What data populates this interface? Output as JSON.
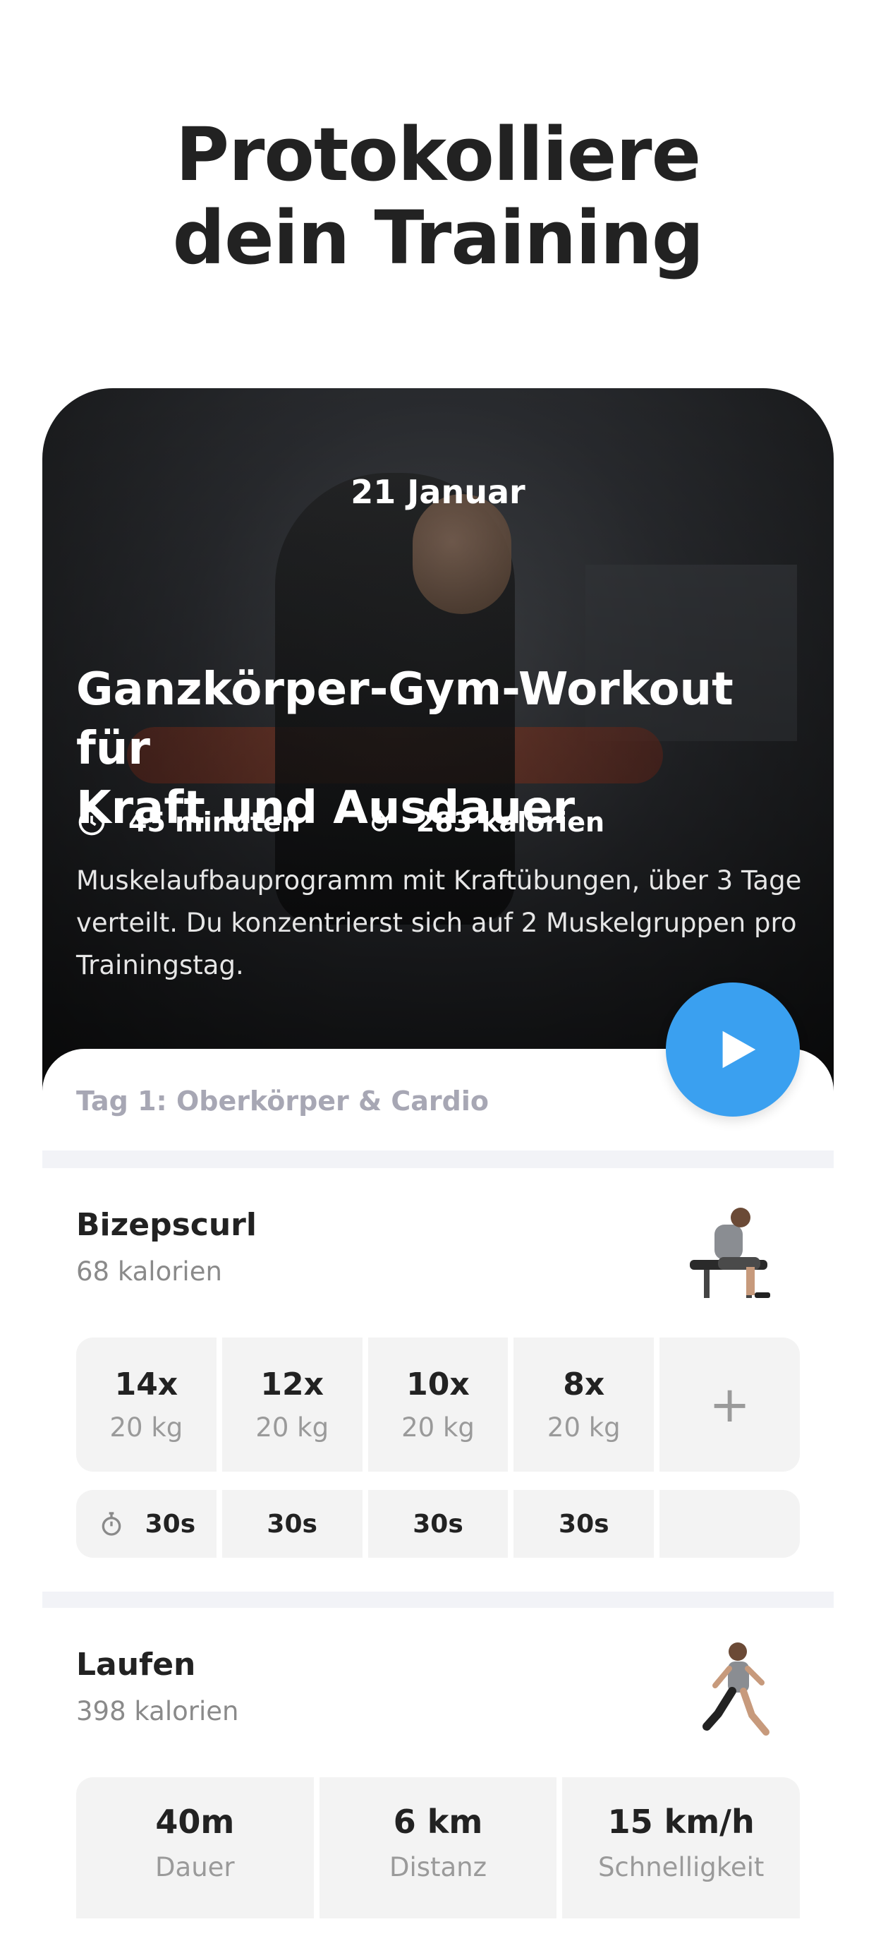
{
  "headline": {
    "line1": "Protokolliere",
    "line2": "dein Training"
  },
  "workout": {
    "date": "21 Januar",
    "title_line1": "Ganzkörper-Gym-Workout für",
    "title_line2": "Kraft und Ausdauer",
    "duration": "45 minuten",
    "calories": "283 kalorien",
    "description": "Muskelaufbauprogramm mit Kraftübungen, über 3 Tage verteilt. Du konzentrierst sich auf 2 Muskelgruppen pro Trainingstag.",
    "day_label": "Tag 1: Oberkörper & Cardio",
    "accent_color": "#3aa0f0"
  },
  "exercises": [
    {
      "name": "Bizepscurl",
      "calories": "68 kalorien",
      "sets": [
        {
          "reps": "14x",
          "weight": "20 kg"
        },
        {
          "reps": "12x",
          "weight": "20 kg"
        },
        {
          "reps": "10x",
          "weight": "20 kg"
        },
        {
          "reps": "8x",
          "weight": "20 kg"
        }
      ],
      "add_label": "+",
      "rests": [
        "30s",
        "30s",
        "30s",
        "30s"
      ]
    },
    {
      "name": "Laufen",
      "calories": "398 kalorien",
      "stats": [
        {
          "value": "40m",
          "label": "Dauer"
        },
        {
          "value": "6 km",
          "label": "Distanz"
        },
        {
          "value": "15 km/h",
          "label": "Schnelligkeit"
        }
      ]
    }
  ]
}
